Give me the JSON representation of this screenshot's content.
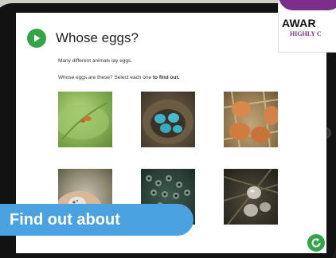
{
  "lesson": {
    "title": "Whose eggs?",
    "intro": "Many different animals lay eggs.",
    "prompt_lead": "Whose eggs are these? Select each one ",
    "prompt_emphasis": "to find out."
  },
  "egg_tiles": [
    {
      "description": "eggs on green leaf"
    },
    {
      "description": "blue eggs in nest"
    },
    {
      "description": "brown eggs in straw"
    },
    {
      "description": "speckled egg in hand"
    },
    {
      "description": "frogspawn"
    },
    {
      "description": "grey eggs in nest"
    }
  ],
  "banner": {
    "label": "Find out about"
  },
  "award": {
    "title": "AWAR",
    "subtitle": "HIGHLY C"
  },
  "icons": {
    "play": "play-icon",
    "refresh": "refresh-icon"
  },
  "colors": {
    "accent_green": "#35a34a",
    "banner_blue": "#4aa3e0",
    "award_purple": "#7b2f8a"
  }
}
